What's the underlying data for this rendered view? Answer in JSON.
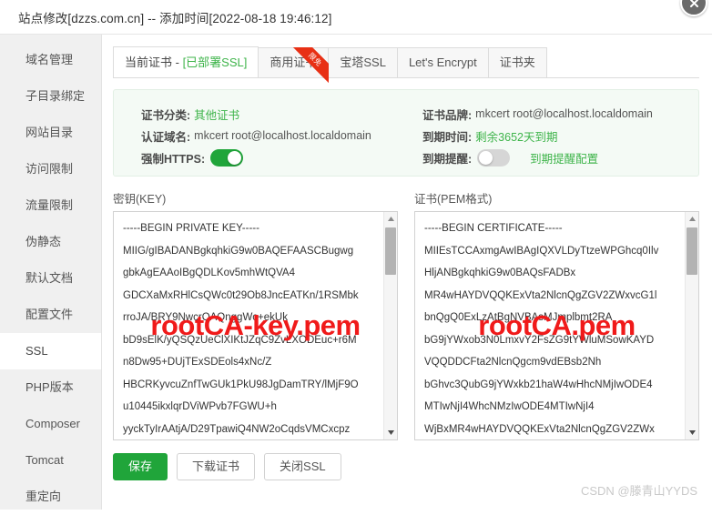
{
  "window": {
    "title": "站点修改[dzzs.com.cn] -- 添加时间[2022-08-18 19:46:12]",
    "close_icon": "close-icon"
  },
  "sidebar": {
    "items": [
      {
        "label": "域名管理",
        "active": false
      },
      {
        "label": "子目录绑定",
        "active": false
      },
      {
        "label": "网站目录",
        "active": false
      },
      {
        "label": "访问限制",
        "active": false
      },
      {
        "label": "流量限制",
        "active": false
      },
      {
        "label": "伪静态",
        "active": false
      },
      {
        "label": "默认文档",
        "active": false
      },
      {
        "label": "配置文件",
        "active": false
      },
      {
        "label": "SSL",
        "active": true
      },
      {
        "label": "PHP版本",
        "active": false
      },
      {
        "label": "Composer",
        "active": false
      },
      {
        "label": "Tomcat",
        "active": false
      },
      {
        "label": "重定向",
        "active": false
      }
    ]
  },
  "tabs": [
    {
      "label": "当前证书 - ",
      "sub": "[已部署SSL]",
      "active": true,
      "ribbon": ""
    },
    {
      "label": "商用证书",
      "sub": "",
      "active": false,
      "ribbon": "限免"
    },
    {
      "label": "宝塔SSL",
      "sub": "",
      "active": false,
      "ribbon": ""
    },
    {
      "label": "Let's Encrypt",
      "sub": "",
      "active": false,
      "ribbon": ""
    },
    {
      "label": "证书夹",
      "sub": "",
      "active": false,
      "ribbon": ""
    }
  ],
  "info": {
    "left": {
      "category_label": "证书分类:",
      "category_value": "其他证书",
      "domain_label": "认证域名:",
      "domain_value": "mkcert root@localhost.localdomain",
      "https_label": "强制HTTPS:",
      "https_state": "on"
    },
    "right": {
      "brand_label": "证书品牌:",
      "brand_value": "mkcert root@localhost.localdomain",
      "expiry_label": "到期时间:",
      "expiry_value": "剩余3652天到期",
      "reminder_label": "到期提醒:",
      "reminder_state": "off",
      "reminder_link": "到期提醒配置"
    }
  },
  "key_panel": {
    "label": "密钥(KEY)",
    "watermark": "rootCA-key.pem",
    "lines": [
      "-----BEGIN PRIVATE KEY-----",
      "MIIG/gIBADANBgkqhkiG9w0BAQEFAASCBugwg",
      "gbkAgEAAoIBgQDLKov5mhWtQVA4",
      "GDCXaMxRHlCsQWc0t29Ob8JncEATKn/1RSMbk",
      "rroJA/BRY9NwcrQAQnggWc+ekUk",
      "bD9sElK/yQSQzUeClXIKtJZqC9ZvLXODEuc+r6M",
      "n8Dw95+DUjTExSDEols4xNc/Z",
      "HBCRKyvcuZnfTwGUk1PkU98JgDamTRY/lMjF9O",
      "u10445ikxlqrDViWPvb7FGWU+h",
      "yyckTyIrAAtjA/D29TpawiQ4NW2oCqdsVMCxcpz"
    ]
  },
  "cert_panel": {
    "label": "证书(PEM格式)",
    "watermark": "rootCA.pem",
    "lines": [
      "-----BEGIN CERTIFICATE-----",
      "MIIEsTCCAxmgAwIBAgIQXVLDyTtzeWPGhcq0Ilv",
      "HljANBgkqhkiG9w0BAQsFADBx",
      "MR4wHAYDVQQKExVta2NlcnQgZGV2ZWxvcG1l",
      "bnQgQ0ExLzAtBgNVBAsMJmplbmt2RA",
      "bG9jYWxob3N0LmxvY2FsZG9tYWluMSowKAYD",
      "VQQDDCFta2NlcnQgcm9vdEBsb2Nh",
      "bGhvc3QubG9jYWxkb21haW4wHhcNMjIwODE4",
      "MTIwNjI4WhcNMzIwODE4MTIwNjI4",
      "WjBxMR4wHAYDVQQKExVta2NlcnQgZGV2ZWx"
    ]
  },
  "buttons": [
    {
      "label": "保存",
      "style": "primary"
    },
    {
      "label": "下载证书",
      "style": "default"
    },
    {
      "label": "关闭SSL",
      "style": "default"
    }
  ],
  "watermark": "CSDN @滕青山YYDS",
  "colors": {
    "accent_green": "#20a53a",
    "link_green": "#3eb44a",
    "ribbon_red": "#e83015",
    "watermark_red": "#f01a1a",
    "panel_bg": "#f4faf5",
    "sidebar_bg": "#f0f0f0"
  }
}
